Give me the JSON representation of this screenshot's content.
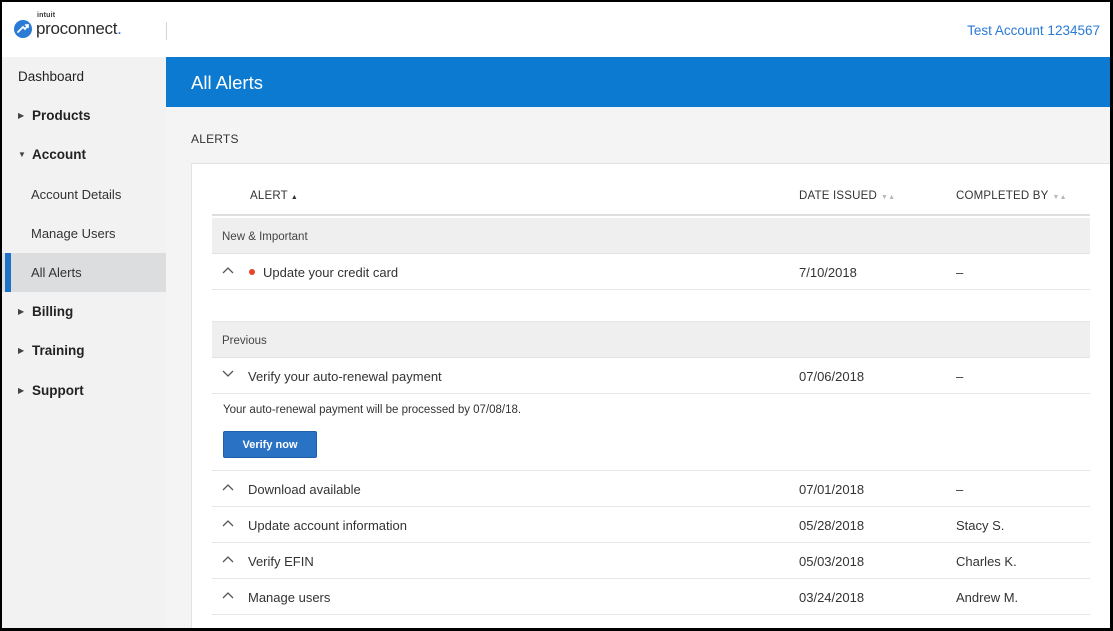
{
  "header": {
    "logo_small": "intuit",
    "logo_main": "proconnect",
    "account_label": "Test Account 1234567"
  },
  "sidebar": {
    "items": [
      {
        "label": "Dashboard",
        "type": "top"
      },
      {
        "label": "Products",
        "type": "parent",
        "expanded": false
      },
      {
        "label": "Account",
        "type": "parent",
        "expanded": true
      },
      {
        "label": "Account Details",
        "type": "child"
      },
      {
        "label": "Manage Users",
        "type": "child"
      },
      {
        "label": "All Alerts",
        "type": "child",
        "active": true
      },
      {
        "label": "Billing",
        "type": "parent",
        "expanded": false
      },
      {
        "label": "Training",
        "type": "parent",
        "expanded": false
      },
      {
        "label": "Support",
        "type": "parent",
        "expanded": false
      }
    ]
  },
  "banner": {
    "title": "All Alerts"
  },
  "main": {
    "section_label": "ALERTS",
    "columns": {
      "alert": "ALERT",
      "date": "DATE ISSUED",
      "completed": "COMPLETED BY"
    },
    "groups": [
      {
        "label": "New & Important",
        "rows": [
          {
            "title": "Update your credit card",
            "date": "7/10/2018",
            "by": "–",
            "unread": true
          }
        ]
      },
      {
        "label": "Previous",
        "rows": [
          {
            "title": "Verify your auto-renewal payment",
            "date": "07/06/2018",
            "by": "–",
            "expanded": true
          },
          {
            "title": "Download available",
            "date": "07/01/2018",
            "by": "–"
          },
          {
            "title": "Update account information",
            "date": "05/28/2018",
            "by": "Stacy S."
          },
          {
            "title": "Verify EFIN",
            "date": "05/03/2018",
            "by": "Charles K."
          },
          {
            "title": "Manage users",
            "date": "03/24/2018",
            "by": "Andrew M."
          }
        ]
      }
    ],
    "expanded_detail": {
      "text": "Your auto-renewal payment will be processed by 07/08/18.",
      "button_label": "Verify now"
    }
  },
  "colors": {
    "brand_blue": "#0b7ad0",
    "link_blue": "#2a7ad6",
    "alert_dot": "#e84526"
  }
}
